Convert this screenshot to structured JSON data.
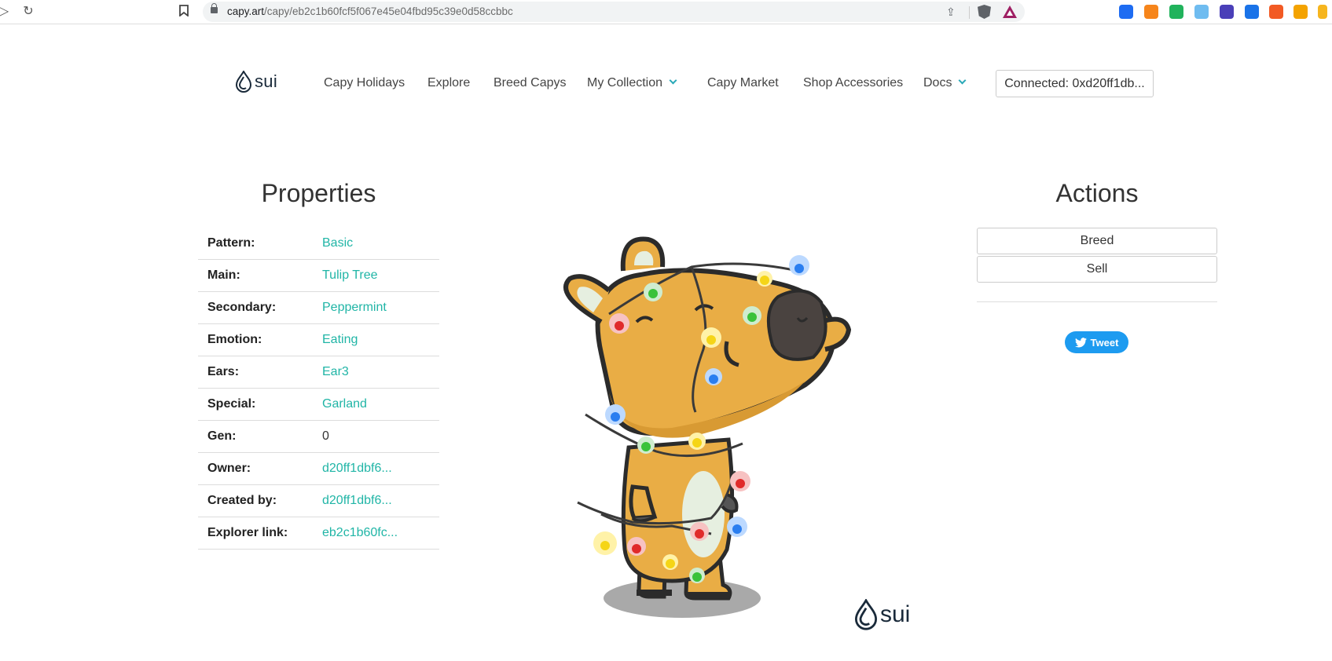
{
  "browser": {
    "url_host": "capy.art",
    "url_path": "/capy/eb2c1b60fcf5f067e45e04fbd95c39e0d58ccbbc",
    "extensions": [
      {
        "name": "keplr-icon",
        "color": "#1e6cf2"
      },
      {
        "name": "metamask-icon",
        "color": "#f6851b"
      },
      {
        "name": "polkadot-icon",
        "color": "#21b35c"
      },
      {
        "name": "sui-wallet-icon",
        "color": "#6fbcf0"
      },
      {
        "name": "discord-icon",
        "color": "#4a3fb8"
      },
      {
        "name": "puzzle-icon",
        "color": "#1a73e8"
      },
      {
        "name": "slope-icon",
        "color": "#f25a24"
      },
      {
        "name": "spartan-icon",
        "color": "#f4a300"
      },
      {
        "name": "avatar-extension-icon",
        "color": "#f6b51e"
      }
    ]
  },
  "site": {
    "logo_text": "sui",
    "menu": [
      {
        "label": "Capy Holidays",
        "dropdown": false
      },
      {
        "label": "Explore",
        "dropdown": false
      },
      {
        "label": "Breed Capys",
        "dropdown": false
      },
      {
        "label": "My Collection",
        "dropdown": true
      },
      {
        "label": "Capy Market",
        "dropdown": false
      },
      {
        "label": "Shop Accessories",
        "dropdown": false
      },
      {
        "label": "Docs",
        "dropdown": true
      }
    ],
    "connect_label": "Connected: 0xd20ff1db..."
  },
  "properties": {
    "title": "Properties",
    "rows": [
      {
        "key": "Pattern:",
        "value": "Basic",
        "link": true
      },
      {
        "key": "Main:",
        "value": "Tulip Tree",
        "link": true
      },
      {
        "key": "Secondary:",
        "value": "Peppermint",
        "link": true
      },
      {
        "key": "Emotion:",
        "value": "Eating",
        "link": true
      },
      {
        "key": "Ears:",
        "value": "Ear3",
        "link": true
      },
      {
        "key": "Special:",
        "value": "Garland",
        "link": true
      },
      {
        "key": "Gen:",
        "value": "0",
        "link": false
      },
      {
        "key": "Owner:",
        "value": "d20ff1dbf6...",
        "link": true
      },
      {
        "key": "Created by:",
        "value": "d20ff1dbf6...",
        "link": true
      },
      {
        "key": "Explorer link:",
        "value": "eb2c1b60fc...",
        "link": true
      }
    ]
  },
  "capy_image": {
    "watermark": "sui"
  },
  "actions": {
    "title": "Actions",
    "breed_label": "Breed",
    "sell_label": "Sell",
    "tweet_label": "Tweet"
  },
  "colors": {
    "accent": "#20b5a6",
    "capy_body": "#e9ad45",
    "tweet": "#1d9bf0"
  }
}
